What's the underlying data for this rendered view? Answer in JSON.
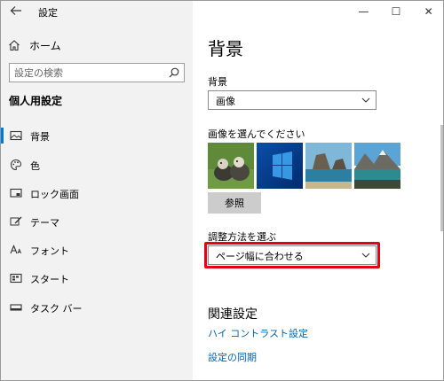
{
  "app": {
    "title": "設定",
    "window_controls": {
      "minimize": "—",
      "maximize": "☐",
      "close": "✕"
    }
  },
  "sidebar": {
    "home_label": "ホーム",
    "search_placeholder": "設定の検索",
    "section_title": "個人用設定",
    "items": [
      {
        "label": "背景",
        "icon": "picture-icon",
        "active": true
      },
      {
        "label": "色",
        "icon": "palette-icon",
        "active": false
      },
      {
        "label": "ロック画面",
        "icon": "lock-screen-icon",
        "active": false
      },
      {
        "label": "テーマ",
        "icon": "theme-brush-icon",
        "active": false
      },
      {
        "label": "フォント",
        "icon": "font-icon",
        "active": false
      },
      {
        "label": "スタート",
        "icon": "start-icon",
        "active": false
      },
      {
        "label": "タスク バー",
        "icon": "taskbar-icon",
        "active": false
      }
    ]
  },
  "main": {
    "page_title": "背景",
    "background_label": "背景",
    "background_value": "画像",
    "choose_picture_label": "画像を選んでください",
    "thumbnails": [
      "ducklings",
      "windows-blue",
      "beach-rocks",
      "mountain-lake"
    ],
    "browse_label": "参照",
    "fit_label": "調整方法を選ぶ",
    "fit_value": "ページ幅に合わせる",
    "related_title": "関連設定",
    "links": [
      "ハイ コントラスト設定",
      "設定の同期"
    ]
  },
  "colors": {
    "accent": "#0078d7",
    "highlight_border": "#e60012",
    "sidebar_bg": "#f2f2f2",
    "link": "#0066b4"
  }
}
